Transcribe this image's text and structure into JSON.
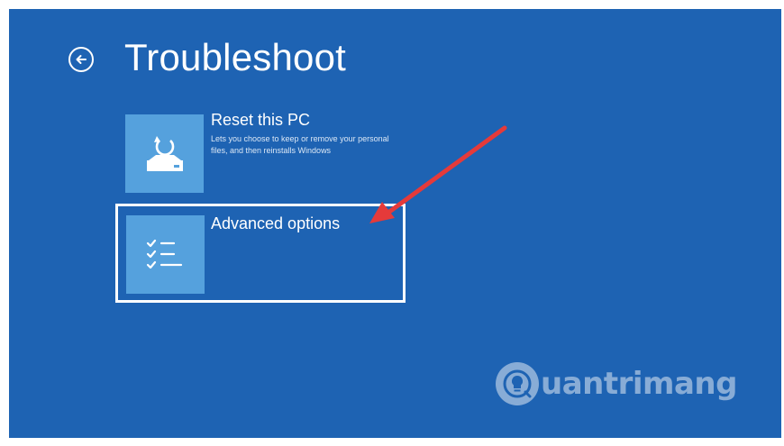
{
  "page": {
    "title": "Troubleshoot"
  },
  "options": [
    {
      "label": "Reset this PC",
      "description": "Lets you choose to keep or remove your personal files, and then reinstalls Windows",
      "icon": "reset-pc-icon",
      "selected": false
    },
    {
      "label": "Advanced options",
      "description": "",
      "icon": "checklist-icon",
      "selected": true
    }
  ],
  "watermark": {
    "text": "uantrimang",
    "icon": "lightbulb-q-logo"
  },
  "colors": {
    "background": "#1e63b3",
    "tile_icon_bg": "#55a1dd",
    "arrow": "#e53a3a",
    "text": "#ffffff"
  }
}
